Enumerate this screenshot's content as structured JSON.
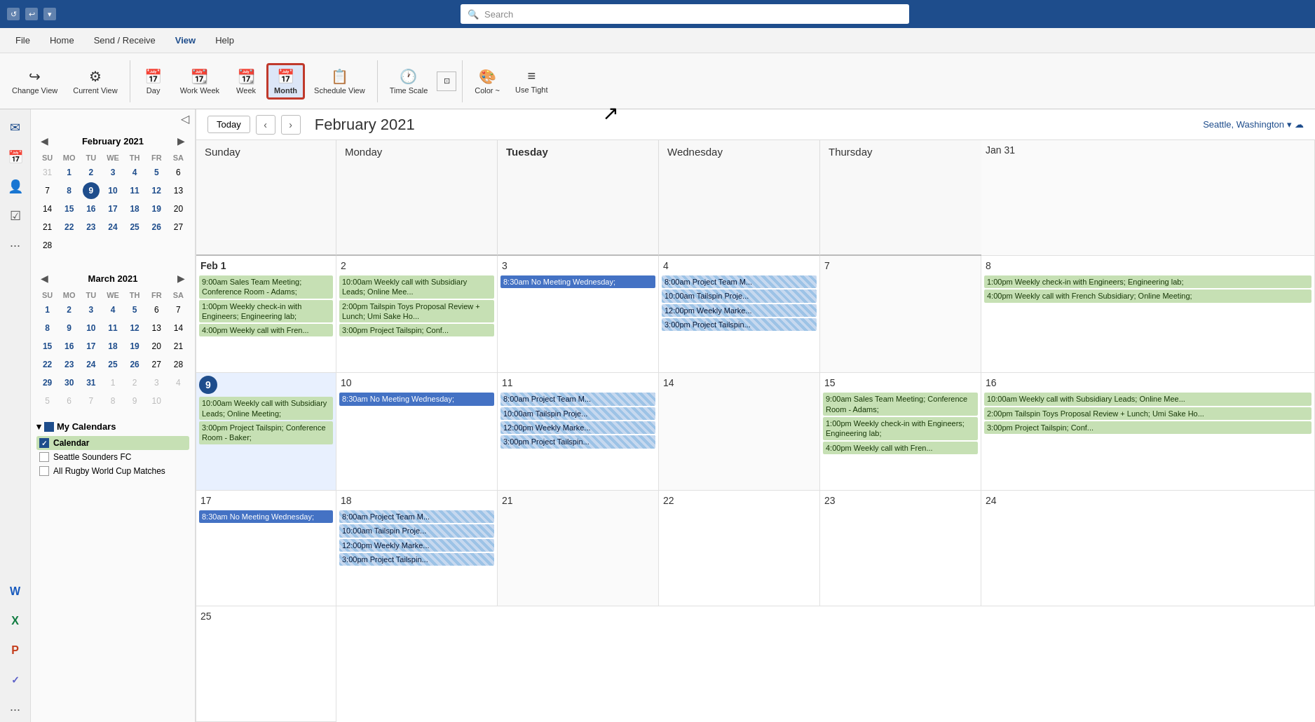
{
  "titleBar": {
    "search_placeholder": "Search"
  },
  "menuBar": {
    "items": [
      "File",
      "Home",
      "Send / Receive",
      "View",
      "Help"
    ],
    "active": "View"
  },
  "ribbon": {
    "changeView": "Change View",
    "currentView": "Current View",
    "day": "Day",
    "workWeek": "Work Week",
    "week": "Week",
    "month": "Month",
    "scheduleView": "Schedule View",
    "timeScale": "Time Scale",
    "color": "Color ~",
    "useTight": "Use Tight"
  },
  "calNav": {
    "today": "Today",
    "title": "February 2021",
    "location": "Seattle, Washington"
  },
  "columnHeaders": [
    "Sunday",
    "Monday",
    "Tuesday",
    "Wednesday",
    "Thursday"
  ],
  "weeks": [
    {
      "cells": [
        {
          "date": "Jan 31",
          "col": "sunday",
          "events": []
        },
        {
          "date": "Feb 1",
          "bold": true,
          "col": "monday",
          "events": [
            {
              "type": "green",
              "text": "9:00am Sales Team Meeting; Conference Room - Adams;"
            },
            {
              "type": "green",
              "text": "1:00pm Weekly check-in with Engineers; Engineering lab;"
            },
            {
              "type": "green",
              "text": "4:00pm Weekly call with Fren..."
            }
          ]
        },
        {
          "date": "2",
          "col": "tuesday",
          "events": [
            {
              "type": "green",
              "text": "10:00am Weekly call with Subsidiary Leads; Online Mee..."
            },
            {
              "type": "green",
              "text": "2:00pm Tailspin Toys Proposal Review + Lunch; Umi Sake Ho..."
            },
            {
              "type": "green",
              "text": "3:00pm Project Tailspin; Conf..."
            }
          ]
        },
        {
          "date": "3",
          "col": "wednesday",
          "events": [
            {
              "type": "blue",
              "text": "8:30am No Meeting Wednesday;"
            }
          ]
        },
        {
          "date": "4",
          "col": "thursday",
          "events": [
            {
              "type": "striped",
              "text": "8:00am Project Team M..."
            },
            {
              "type": "striped",
              "text": "10:00am Tailspin Proje..."
            },
            {
              "type": "striped",
              "text": "12:00pm Weekly Marke..."
            },
            {
              "type": "striped",
              "text": "3:00pm Project Tailspin..."
            }
          ]
        }
      ]
    },
    {
      "cells": [
        {
          "date": "7",
          "col": "sunday",
          "events": []
        },
        {
          "date": "8",
          "col": "monday",
          "events": [
            {
              "type": "green",
              "text": "1:00pm Weekly check-in with Engineers; Engineering lab;"
            },
            {
              "type": "green",
              "text": "4:00pm Weekly call with French Subsidiary; Online Meeting;"
            }
          ]
        },
        {
          "date": "9",
          "col": "tuesday",
          "today": true,
          "events": [
            {
              "type": "green",
              "text": "10:00am Weekly call with Subsidiary Leads; Online Meeting;"
            },
            {
              "type": "green",
              "text": "3:00pm Project Tailspin; Conference Room - Baker;"
            }
          ]
        },
        {
          "date": "10",
          "col": "wednesday",
          "events": [
            {
              "type": "blue",
              "text": "8:30am No Meeting Wednesday;"
            }
          ]
        },
        {
          "date": "11",
          "col": "thursday",
          "events": [
            {
              "type": "striped",
              "text": "8:00am Project Team M..."
            },
            {
              "type": "striped",
              "text": "10:00am Tailspin Proje..."
            },
            {
              "type": "striped",
              "text": "12:00pm Weekly Marke..."
            },
            {
              "type": "striped",
              "text": "3:00pm Project Tailspin..."
            }
          ]
        }
      ]
    },
    {
      "cells": [
        {
          "date": "14",
          "col": "sunday",
          "events": []
        },
        {
          "date": "15",
          "col": "monday",
          "events": [
            {
              "type": "green",
              "text": "9:00am Sales Team Meeting; Conference Room - Adams;"
            },
            {
              "type": "green",
              "text": "1:00pm Weekly check-in with Engineers; Engineering lab;"
            },
            {
              "type": "green",
              "text": "4:00pm Weekly call with Fren..."
            }
          ]
        },
        {
          "date": "16",
          "col": "tuesday",
          "events": [
            {
              "type": "green",
              "text": "10:00am Weekly call with Subsidiary Leads; Online Mee..."
            },
            {
              "type": "green",
              "text": "2:00pm Tailspin Toys Proposal Review + Lunch; Umi Sake Ho..."
            },
            {
              "type": "green",
              "text": "3:00pm Project Tailspin; Conf..."
            }
          ]
        },
        {
          "date": "17",
          "col": "wednesday",
          "events": [
            {
              "type": "blue",
              "text": "8:30am No Meeting Wednesday;"
            }
          ]
        },
        {
          "date": "18",
          "col": "thursday",
          "events": [
            {
              "type": "striped",
              "text": "8:00am Project Team M..."
            },
            {
              "type": "striped",
              "text": "10:00am Tailspin Proje..."
            },
            {
              "type": "striped",
              "text": "12:00pm Weekly Marke..."
            },
            {
              "type": "striped",
              "text": "3:00pm Project Tailspin..."
            }
          ]
        }
      ]
    },
    {
      "cells": [
        {
          "date": "21",
          "col": "sunday",
          "events": []
        },
        {
          "date": "22",
          "col": "monday",
          "events": []
        },
        {
          "date": "23",
          "col": "tuesday",
          "events": []
        },
        {
          "date": "24",
          "col": "wednesday",
          "events": []
        },
        {
          "date": "25",
          "col": "thursday",
          "events": []
        }
      ]
    }
  ],
  "miniCalFeb": {
    "title": "February 2021",
    "dayHeaders": [
      "SU",
      "MO",
      "TU",
      "WE",
      "TH",
      "FR",
      "SA"
    ],
    "days": [
      {
        "d": "31",
        "other": true
      },
      {
        "d": "1",
        "bold": true
      },
      {
        "d": "2",
        "bold": true
      },
      {
        "d": "3",
        "bold": true
      },
      {
        "d": "4",
        "bold": true
      },
      {
        "d": "5",
        "bold": true
      },
      {
        "d": "6"
      },
      {
        "d": "7"
      },
      {
        "d": "8",
        "bold": true
      },
      {
        "d": "9",
        "bold": true,
        "today": true
      },
      {
        "d": "10",
        "bold": true
      },
      {
        "d": "11",
        "bold": true
      },
      {
        "d": "12",
        "bold": true
      },
      {
        "d": "13"
      },
      {
        "d": "14"
      },
      {
        "d": "15",
        "bold": true
      },
      {
        "d": "16",
        "bold": true
      },
      {
        "d": "17",
        "bold": true
      },
      {
        "d": "18",
        "bold": true
      },
      {
        "d": "19",
        "bold": true
      },
      {
        "d": "20"
      },
      {
        "d": "21"
      },
      {
        "d": "22",
        "bold": true
      },
      {
        "d": "23",
        "bold": true
      },
      {
        "d": "24",
        "bold": true
      },
      {
        "d": "25",
        "bold": true
      },
      {
        "d": "26",
        "bold": true
      },
      {
        "d": "27"
      },
      {
        "d": "28"
      }
    ]
  },
  "miniCalMar": {
    "title": "March 2021",
    "dayHeaders": [
      "SU",
      "MO",
      "TU",
      "WE",
      "TH",
      "FR",
      "SA"
    ],
    "days": [
      {
        "d": "1",
        "bold": true
      },
      {
        "d": "2",
        "bold": true
      },
      {
        "d": "3",
        "bold": true
      },
      {
        "d": "4",
        "bold": true
      },
      {
        "d": "5",
        "bold": true
      },
      {
        "d": "6"
      },
      {
        "d": "7"
      },
      {
        "d": "8",
        "bold": true
      },
      {
        "d": "9",
        "bold": true
      },
      {
        "d": "10",
        "bold": true
      },
      {
        "d": "11",
        "bold": true
      },
      {
        "d": "12",
        "bold": true
      },
      {
        "d": "13"
      },
      {
        "d": "14"
      },
      {
        "d": "15",
        "bold": true
      },
      {
        "d": "16",
        "bold": true
      },
      {
        "d": "17",
        "bold": true
      },
      {
        "d": "18",
        "bold": true
      },
      {
        "d": "19",
        "bold": true
      },
      {
        "d": "20"
      },
      {
        "d": "21"
      },
      {
        "d": "22",
        "bold": true
      },
      {
        "d": "23",
        "bold": true
      },
      {
        "d": "24",
        "bold": true
      },
      {
        "d": "25",
        "bold": true
      },
      {
        "d": "26",
        "bold": true
      },
      {
        "d": "27"
      },
      {
        "d": "28"
      },
      {
        "d": "29",
        "bold": true
      },
      {
        "d": "30",
        "bold": true
      },
      {
        "d": "31",
        "bold": true
      },
      {
        "d": "1",
        "other": true
      },
      {
        "d": "2",
        "other": true
      },
      {
        "d": "3",
        "other": true
      },
      {
        "d": "4",
        "other": true
      },
      {
        "d": "5",
        "other": true
      },
      {
        "d": "6",
        "other": true
      },
      {
        "d": "7",
        "other": true
      },
      {
        "d": "8",
        "other": true
      },
      {
        "d": "9",
        "other": true
      },
      {
        "d": "10",
        "other": true
      }
    ]
  },
  "myCalendars": {
    "label": "My Calendars",
    "items": [
      {
        "name": "Calendar",
        "checked": true,
        "highlighted": true
      },
      {
        "name": "Seattle Sounders FC",
        "checked": false
      },
      {
        "name": "All Rugby World Cup Matches",
        "checked": false
      }
    ]
  }
}
